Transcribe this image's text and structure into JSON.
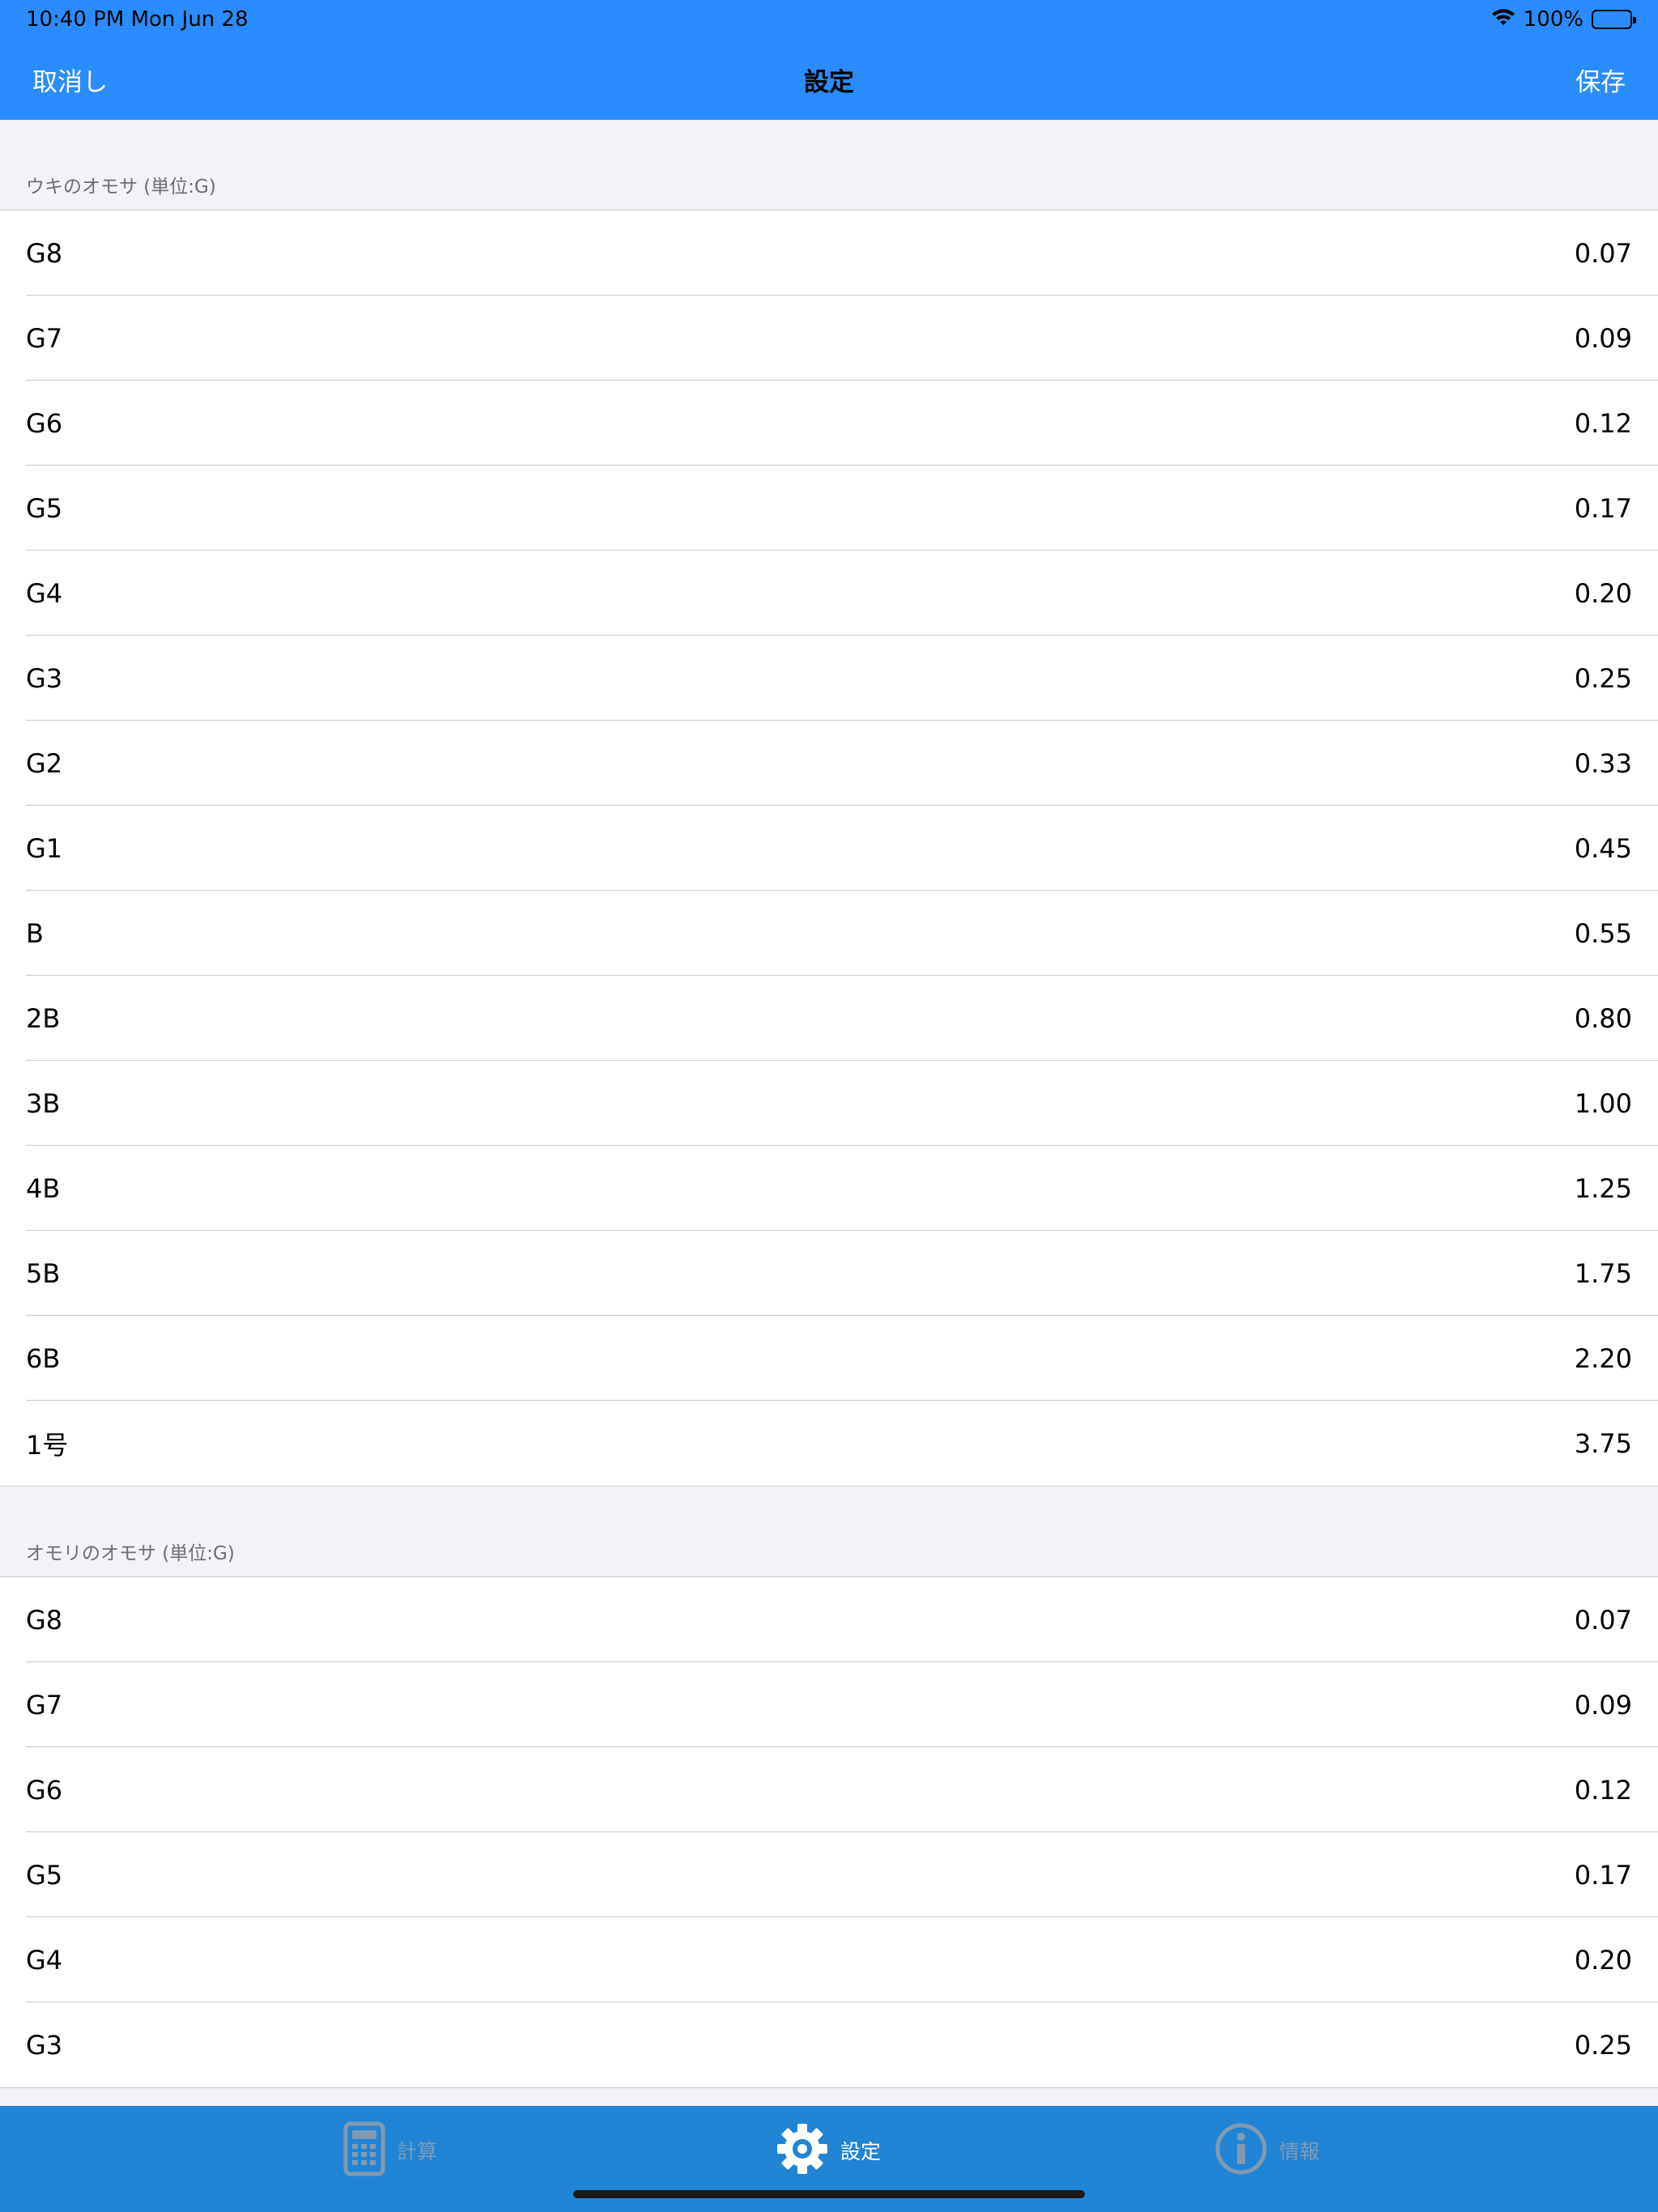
{
  "status_bar": {
    "time": "10:40 PM   Mon Jun 28",
    "battery": "100%"
  },
  "nav": {
    "cancel_label": "取消し",
    "title": "設定",
    "save_label": "保存"
  },
  "sections": [
    {
      "header": "ウキのオモサ (単位:G)",
      "rows": [
        {
          "label": "G8",
          "value": "0.07"
        },
        {
          "label": "G7",
          "value": "0.09"
        },
        {
          "label": "G6",
          "value": "0.12"
        },
        {
          "label": "G5",
          "value": "0.17"
        },
        {
          "label": "G4",
          "value": "0.20"
        },
        {
          "label": "G3",
          "value": "0.25"
        },
        {
          "label": "G2",
          "value": "0.33"
        },
        {
          "label": "G1",
          "value": "0.45"
        },
        {
          "label": "B",
          "value": "0.55"
        },
        {
          "label": "2B",
          "value": "0.80"
        },
        {
          "label": "3B",
          "value": "1.00"
        },
        {
          "label": "4B",
          "value": "1.25"
        },
        {
          "label": "5B",
          "value": "1.75"
        },
        {
          "label": "6B",
          "value": "2.20"
        },
        {
          "label": "1号",
          "value": "3.75"
        }
      ]
    },
    {
      "header": "オモリのオモサ (単位:G)",
      "rows": [
        {
          "label": "G8",
          "value": "0.07"
        },
        {
          "label": "G7",
          "value": "0.09"
        },
        {
          "label": "G6",
          "value": "0.12"
        },
        {
          "label": "G5",
          "value": "0.17"
        },
        {
          "label": "G4",
          "value": "0.20"
        },
        {
          "label": "G3",
          "value": "0.25"
        }
      ]
    }
  ],
  "tabs": [
    {
      "label": "計算",
      "icon": "calculator-icon",
      "active": false
    },
    {
      "label": "設定",
      "icon": "gear-icon",
      "active": true
    },
    {
      "label": "情報",
      "icon": "info-icon",
      "active": false
    }
  ],
  "colors": {
    "nav_bar": "#2a8cff",
    "tab_bar": "#2284d4",
    "tab_inactive": "#7d9bb5",
    "tab_active": "#ffffff"
  }
}
